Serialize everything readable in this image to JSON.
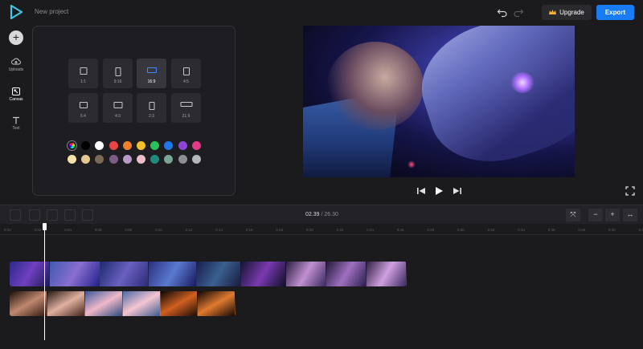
{
  "app": {
    "project_title": "New project",
    "upgrade_label": "Upgrade",
    "export_label": "Export",
    "accent": "#1a7cf2"
  },
  "leftnav": {
    "add_icon": "plus-icon",
    "items": [
      {
        "label": "Uploads",
        "icon": "upload-cloud-icon"
      },
      {
        "label": "Canvas",
        "icon": "canvas-icon"
      },
      {
        "label": "Text",
        "icon": "text-icon"
      }
    ],
    "active": "Canvas"
  },
  "canvas_panel": {
    "ratios": [
      "1:1",
      "9:16",
      "16:9",
      "4:5",
      "5:4",
      "4:3",
      "2:3",
      "21:9"
    ],
    "selected_ratio": "16:9",
    "colors_row1": [
      "#000000",
      "#ffffff",
      "#e94545",
      "#f07f2e",
      "#f5c02a",
      "#27c15a",
      "#1f78e6",
      "#8e44d6",
      "#e23a86"
    ],
    "colors_row2": [
      "#f6e3a8",
      "#e3c890",
      "#7a6a58",
      "#7d5d86",
      "#b99ac7",
      "#f0bccc",
      "#1f8b7f",
      "#7aa493",
      "#8c8f94",
      "#b4b8bc"
    ]
  },
  "player": {
    "prev_icon": "skip-back-icon",
    "play_icon": "play-icon",
    "next_icon": "skip-forward-icon",
    "fullscreen_icon": "fullscreen-icon"
  },
  "timeline": {
    "current_time": "02.39",
    "separator": "/",
    "total_time": "26.30",
    "ruler_ticks": [
      "0:00",
      "0:02",
      "0:04",
      "0:06",
      "0:08",
      "0:10",
      "0:12",
      "0:14",
      "0:16",
      "0:18",
      "0:20",
      "0:22",
      "0:24",
      "0:26",
      "0:28",
      "0:30",
      "0:32",
      "0:34",
      "0:36",
      "0:38",
      "0:40",
      "0:42"
    ],
    "zoom_minus": "−",
    "zoom_plus": "+",
    "tools": [
      "split-icon",
      "duplicate-icon",
      "align-bottom-icon",
      "align-top-icon",
      "delete-icon"
    ]
  }
}
